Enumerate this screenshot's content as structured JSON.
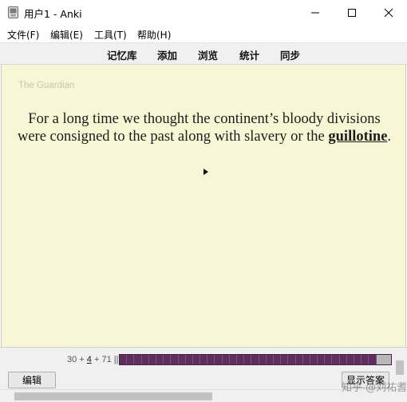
{
  "window": {
    "title": "用户1 - Anki",
    "icons": {
      "app": "anki-app-icon",
      "minimize": "minimize-icon",
      "maximize": "maximize-icon",
      "close": "close-icon"
    }
  },
  "menu": [
    {
      "label": "文件(F)"
    },
    {
      "label": "编辑(E)"
    },
    {
      "label": "工具(T)"
    },
    {
      "label": "帮助(H)"
    }
  ],
  "toolbar": [
    {
      "label": "记忆库"
    },
    {
      "label": "添加"
    },
    {
      "label": "浏览"
    },
    {
      "label": "统计"
    },
    {
      "label": "同步"
    }
  ],
  "card": {
    "source": "The Guardian",
    "sentence_before": "For a long time we thought the continent’s bloody divisions were consigned to the past along with slavery or the ",
    "keyword": "guillotine",
    "sentence_after": ".",
    "play_icon": "play-audio-icon"
  },
  "bottom": {
    "count_new": "30",
    "plus1": " + ",
    "count_learn": "4",
    "plus2": " + ",
    "count_review": "71",
    "separator": " ||",
    "edit_label": "编辑",
    "answer_label": "显示答案",
    "progress_fraction": 0.95
  },
  "watermark": "知乎 @刘祐耆",
  "colors": {
    "card_bg": "#f7f7d5",
    "progress": "#5e2e5c"
  }
}
